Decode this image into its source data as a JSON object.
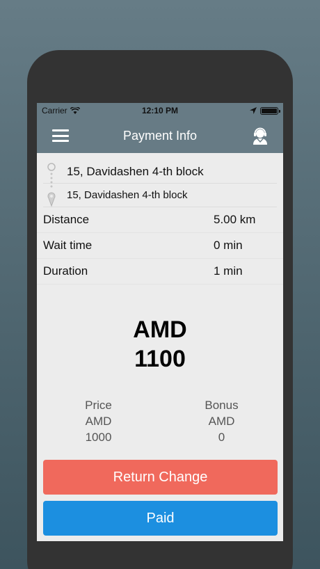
{
  "status_bar": {
    "carrier": "Carrier",
    "time": "12:10 PM"
  },
  "nav": {
    "title": "Payment Info",
    "menu_icon": "hamburger-menu-icon",
    "support_icon": "support-agent-icon"
  },
  "route": {
    "from": "15, Davidashen 4-th block",
    "to": "15, Davidashen 4-th block"
  },
  "trip": [
    {
      "label": "Distance",
      "value": "5.00 km"
    },
    {
      "label": "Wait time",
      "value": "0 min"
    },
    {
      "label": "Duration",
      "value": "1 min"
    }
  ],
  "total": {
    "currency": "AMD",
    "amount": "1100"
  },
  "breakdown": {
    "price": {
      "label": "Price",
      "currency": "AMD",
      "value": "1000"
    },
    "bonus": {
      "label": "Bonus",
      "currency": "AMD",
      "value": "0"
    }
  },
  "buttons": {
    "return_change": "Return Change",
    "paid": "Paid"
  },
  "colors": {
    "header": "#677b85",
    "return_change": "#f0695c",
    "paid": "#1c8fe0"
  }
}
